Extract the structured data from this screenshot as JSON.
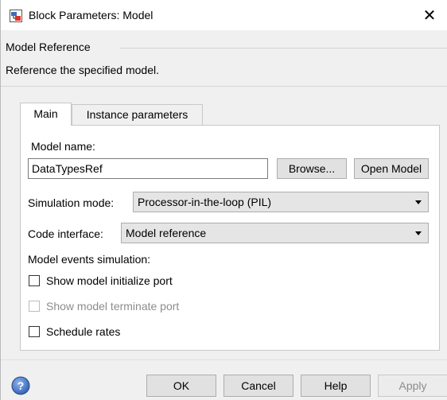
{
  "window": {
    "title": "Block Parameters: Model",
    "close_glyph": "✕"
  },
  "group": {
    "label": "Model Reference",
    "description": "Reference the specified model."
  },
  "tabs": [
    {
      "label": "Main",
      "selected": true
    },
    {
      "label": "Instance parameters",
      "selected": false
    }
  ],
  "main": {
    "model_name_label": "Model name:",
    "model_name_value": "DataTypesRef",
    "browse_label": "Browse...",
    "open_model_label": "Open Model",
    "simulation_mode_label": "Simulation mode:",
    "simulation_mode_value": "Processor-in-the-loop (PIL)",
    "code_interface_label": "Code interface:",
    "code_interface_value": "Model reference",
    "events_label": "Model events simulation:",
    "checkboxes": [
      {
        "label": "Show model initialize port",
        "checked": false,
        "enabled": true
      },
      {
        "label": "Show model terminate port",
        "checked": false,
        "enabled": false
      },
      {
        "label": "Schedule rates",
        "checked": false,
        "enabled": true
      }
    ]
  },
  "footer": {
    "ok_label": "OK",
    "cancel_label": "Cancel",
    "help_label": "Help",
    "apply_label": "Apply",
    "apply_enabled": false
  },
  "icons": {
    "app": "simulink-block-icon",
    "help": "help-question-icon"
  },
  "colors": {
    "background": "#f0f0f0",
    "panel": "#ffffff",
    "help_blue": "#3f74c6"
  }
}
